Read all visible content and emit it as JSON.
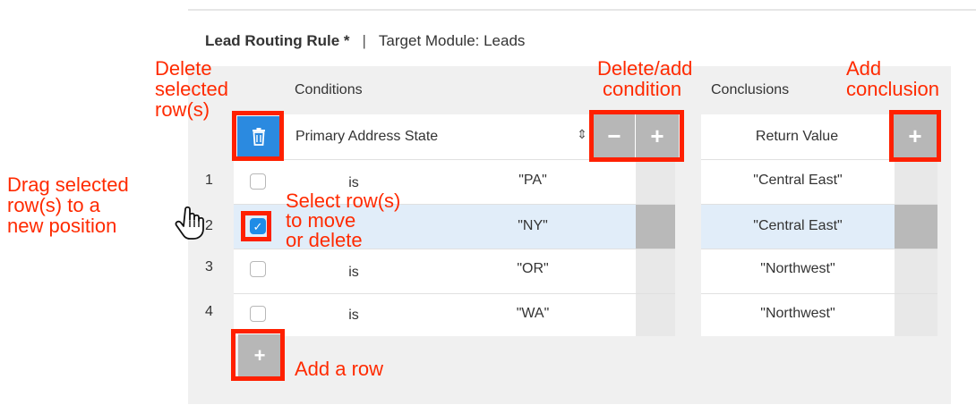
{
  "header": {
    "rule_label": "Lead Routing Rule *",
    "separator": "|",
    "target_module": "Target Module: Leads"
  },
  "conditions": {
    "title": "Conditions",
    "field_select": "Primary Address State",
    "select_arrows": "⇕",
    "remove_condition": "−",
    "add_condition": "+"
  },
  "conclusions": {
    "title": "Conclusions",
    "return_value_header": "Return Value",
    "add_conclusion": "+"
  },
  "rows": [
    {
      "num": "1",
      "op": "is",
      "value": "\"PA\"",
      "result": "\"Central East\"",
      "checked": false
    },
    {
      "num": "2",
      "op": "is",
      "value": "\"NY\"",
      "result": "\"Central East\"",
      "checked": true
    },
    {
      "num": "3",
      "op": "is",
      "value": "\"OR\"",
      "result": "\"Northwest\"",
      "checked": false
    },
    {
      "num": "4",
      "op": "is",
      "value": "\"WA\"",
      "result": "\"Northwest\"",
      "checked": false
    }
  ],
  "add_row": "+",
  "icons": {
    "trash": "trash-icon",
    "check": "✓",
    "hand": "hand-pointer-icon"
  },
  "annotations": {
    "delete_selected": [
      "Delete",
      "selected",
      "row(s)"
    ],
    "delete_add_condition": [
      "Delete/add",
      "condition"
    ],
    "add_conclusion": [
      "Add",
      "conclusion"
    ],
    "drag": [
      "Drag selected",
      "row(s) to a",
      "new position"
    ],
    "select_rows": [
      "Select row(s)",
      "to move",
      "or delete"
    ],
    "add_row": "Add a row"
  },
  "colors": {
    "accent_blue": "#2b8ae0",
    "annotation_red": "#ff2000",
    "selected_row": "#e1edf9",
    "panel_gray": "#f0f0f0"
  }
}
